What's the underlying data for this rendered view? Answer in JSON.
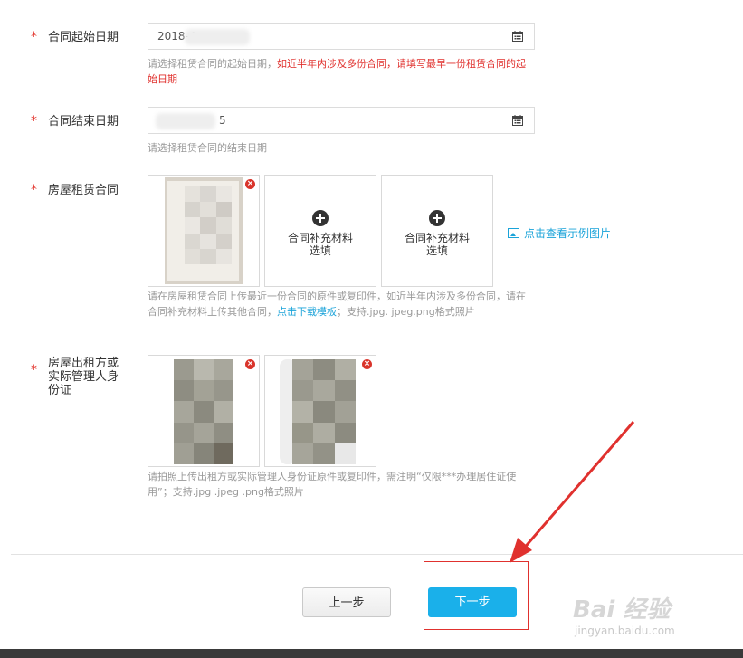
{
  "form": {
    "start_date": {
      "label": "合同起始日期",
      "value": "2018-4",
      "hint_normal": "请选择租赁合同的起始日期，",
      "hint_red": "如近半年内涉及多份合同，请填写最早一份租赁合同的起始日期"
    },
    "end_date": {
      "label": "合同结束日期",
      "value": "5",
      "hint": "请选择租赁合同的结束日期"
    },
    "lease_contract": {
      "label": "房屋租赁合同",
      "add_label_1": "合同补充材料",
      "add_label_2": "选填",
      "example_link": "点击查看示例图片",
      "hint_a": "请在房屋租赁合同上传最近一份合同的原件或复印件，如近半年内涉及多份合同，请在合同补充材料上传其他合同，",
      "hint_link": "点击下载模板",
      "hint_b": "；支持.jpg. jpeg.png格式照片"
    },
    "owner_id": {
      "label": "房屋出租方或实际管理人身份证",
      "hint": "请拍照上传出租方或实际管理人身份证原件或复印件，需注明“仅限***办理居住证使用”；支持.jpg .jpeg .png格式照片"
    }
  },
  "buttons": {
    "prev": "上一步",
    "next": "下一步"
  },
  "watermark": {
    "brand": "Bai 经验",
    "url": "jingyan.baidu.com"
  },
  "colors": {
    "accent_blue": "#1ab0ea",
    "required_red": "#e3362e",
    "highlight_red": "#e0312e"
  }
}
